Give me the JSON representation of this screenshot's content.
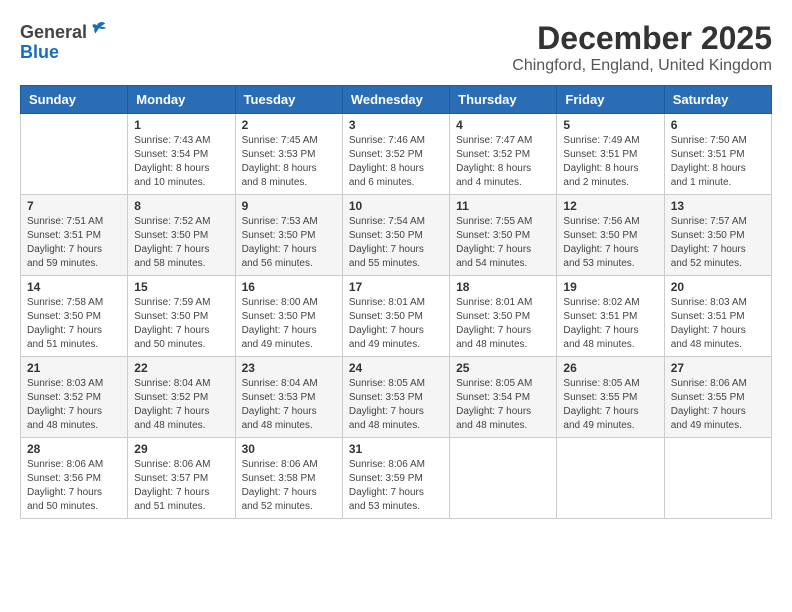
{
  "header": {
    "logo_general": "General",
    "logo_blue": "Blue",
    "title": "December 2025",
    "subtitle": "Chingford, England, United Kingdom"
  },
  "weekdays": [
    "Sunday",
    "Monday",
    "Tuesday",
    "Wednesday",
    "Thursday",
    "Friday",
    "Saturday"
  ],
  "weeks": [
    [
      {
        "day": "",
        "info": ""
      },
      {
        "day": "1",
        "info": "Sunrise: 7:43 AM\nSunset: 3:54 PM\nDaylight: 8 hours\nand 10 minutes."
      },
      {
        "day": "2",
        "info": "Sunrise: 7:45 AM\nSunset: 3:53 PM\nDaylight: 8 hours\nand 8 minutes."
      },
      {
        "day": "3",
        "info": "Sunrise: 7:46 AM\nSunset: 3:52 PM\nDaylight: 8 hours\nand 6 minutes."
      },
      {
        "day": "4",
        "info": "Sunrise: 7:47 AM\nSunset: 3:52 PM\nDaylight: 8 hours\nand 4 minutes."
      },
      {
        "day": "5",
        "info": "Sunrise: 7:49 AM\nSunset: 3:51 PM\nDaylight: 8 hours\nand 2 minutes."
      },
      {
        "day": "6",
        "info": "Sunrise: 7:50 AM\nSunset: 3:51 PM\nDaylight: 8 hours\nand 1 minute."
      }
    ],
    [
      {
        "day": "7",
        "info": "Sunrise: 7:51 AM\nSunset: 3:51 PM\nDaylight: 7 hours\nand 59 minutes."
      },
      {
        "day": "8",
        "info": "Sunrise: 7:52 AM\nSunset: 3:50 PM\nDaylight: 7 hours\nand 58 minutes."
      },
      {
        "day": "9",
        "info": "Sunrise: 7:53 AM\nSunset: 3:50 PM\nDaylight: 7 hours\nand 56 minutes."
      },
      {
        "day": "10",
        "info": "Sunrise: 7:54 AM\nSunset: 3:50 PM\nDaylight: 7 hours\nand 55 minutes."
      },
      {
        "day": "11",
        "info": "Sunrise: 7:55 AM\nSunset: 3:50 PM\nDaylight: 7 hours\nand 54 minutes."
      },
      {
        "day": "12",
        "info": "Sunrise: 7:56 AM\nSunset: 3:50 PM\nDaylight: 7 hours\nand 53 minutes."
      },
      {
        "day": "13",
        "info": "Sunrise: 7:57 AM\nSunset: 3:50 PM\nDaylight: 7 hours\nand 52 minutes."
      }
    ],
    [
      {
        "day": "14",
        "info": "Sunrise: 7:58 AM\nSunset: 3:50 PM\nDaylight: 7 hours\nand 51 minutes."
      },
      {
        "day": "15",
        "info": "Sunrise: 7:59 AM\nSunset: 3:50 PM\nDaylight: 7 hours\nand 50 minutes."
      },
      {
        "day": "16",
        "info": "Sunrise: 8:00 AM\nSunset: 3:50 PM\nDaylight: 7 hours\nand 49 minutes."
      },
      {
        "day": "17",
        "info": "Sunrise: 8:01 AM\nSunset: 3:50 PM\nDaylight: 7 hours\nand 49 minutes."
      },
      {
        "day": "18",
        "info": "Sunrise: 8:01 AM\nSunset: 3:50 PM\nDaylight: 7 hours\nand 48 minutes."
      },
      {
        "day": "19",
        "info": "Sunrise: 8:02 AM\nSunset: 3:51 PM\nDaylight: 7 hours\nand 48 minutes."
      },
      {
        "day": "20",
        "info": "Sunrise: 8:03 AM\nSunset: 3:51 PM\nDaylight: 7 hours\nand 48 minutes."
      }
    ],
    [
      {
        "day": "21",
        "info": "Sunrise: 8:03 AM\nSunset: 3:52 PM\nDaylight: 7 hours\nand 48 minutes."
      },
      {
        "day": "22",
        "info": "Sunrise: 8:04 AM\nSunset: 3:52 PM\nDaylight: 7 hours\nand 48 minutes."
      },
      {
        "day": "23",
        "info": "Sunrise: 8:04 AM\nSunset: 3:53 PM\nDaylight: 7 hours\nand 48 minutes."
      },
      {
        "day": "24",
        "info": "Sunrise: 8:05 AM\nSunset: 3:53 PM\nDaylight: 7 hours\nand 48 minutes."
      },
      {
        "day": "25",
        "info": "Sunrise: 8:05 AM\nSunset: 3:54 PM\nDaylight: 7 hours\nand 48 minutes."
      },
      {
        "day": "26",
        "info": "Sunrise: 8:05 AM\nSunset: 3:55 PM\nDaylight: 7 hours\nand 49 minutes."
      },
      {
        "day": "27",
        "info": "Sunrise: 8:06 AM\nSunset: 3:55 PM\nDaylight: 7 hours\nand 49 minutes."
      }
    ],
    [
      {
        "day": "28",
        "info": "Sunrise: 8:06 AM\nSunset: 3:56 PM\nDaylight: 7 hours\nand 50 minutes."
      },
      {
        "day": "29",
        "info": "Sunrise: 8:06 AM\nSunset: 3:57 PM\nDaylight: 7 hours\nand 51 minutes."
      },
      {
        "day": "30",
        "info": "Sunrise: 8:06 AM\nSunset: 3:58 PM\nDaylight: 7 hours\nand 52 minutes."
      },
      {
        "day": "31",
        "info": "Sunrise: 8:06 AM\nSunset: 3:59 PM\nDaylight: 7 hours\nand 53 minutes."
      },
      {
        "day": "",
        "info": ""
      },
      {
        "day": "",
        "info": ""
      },
      {
        "day": "",
        "info": ""
      }
    ]
  ]
}
